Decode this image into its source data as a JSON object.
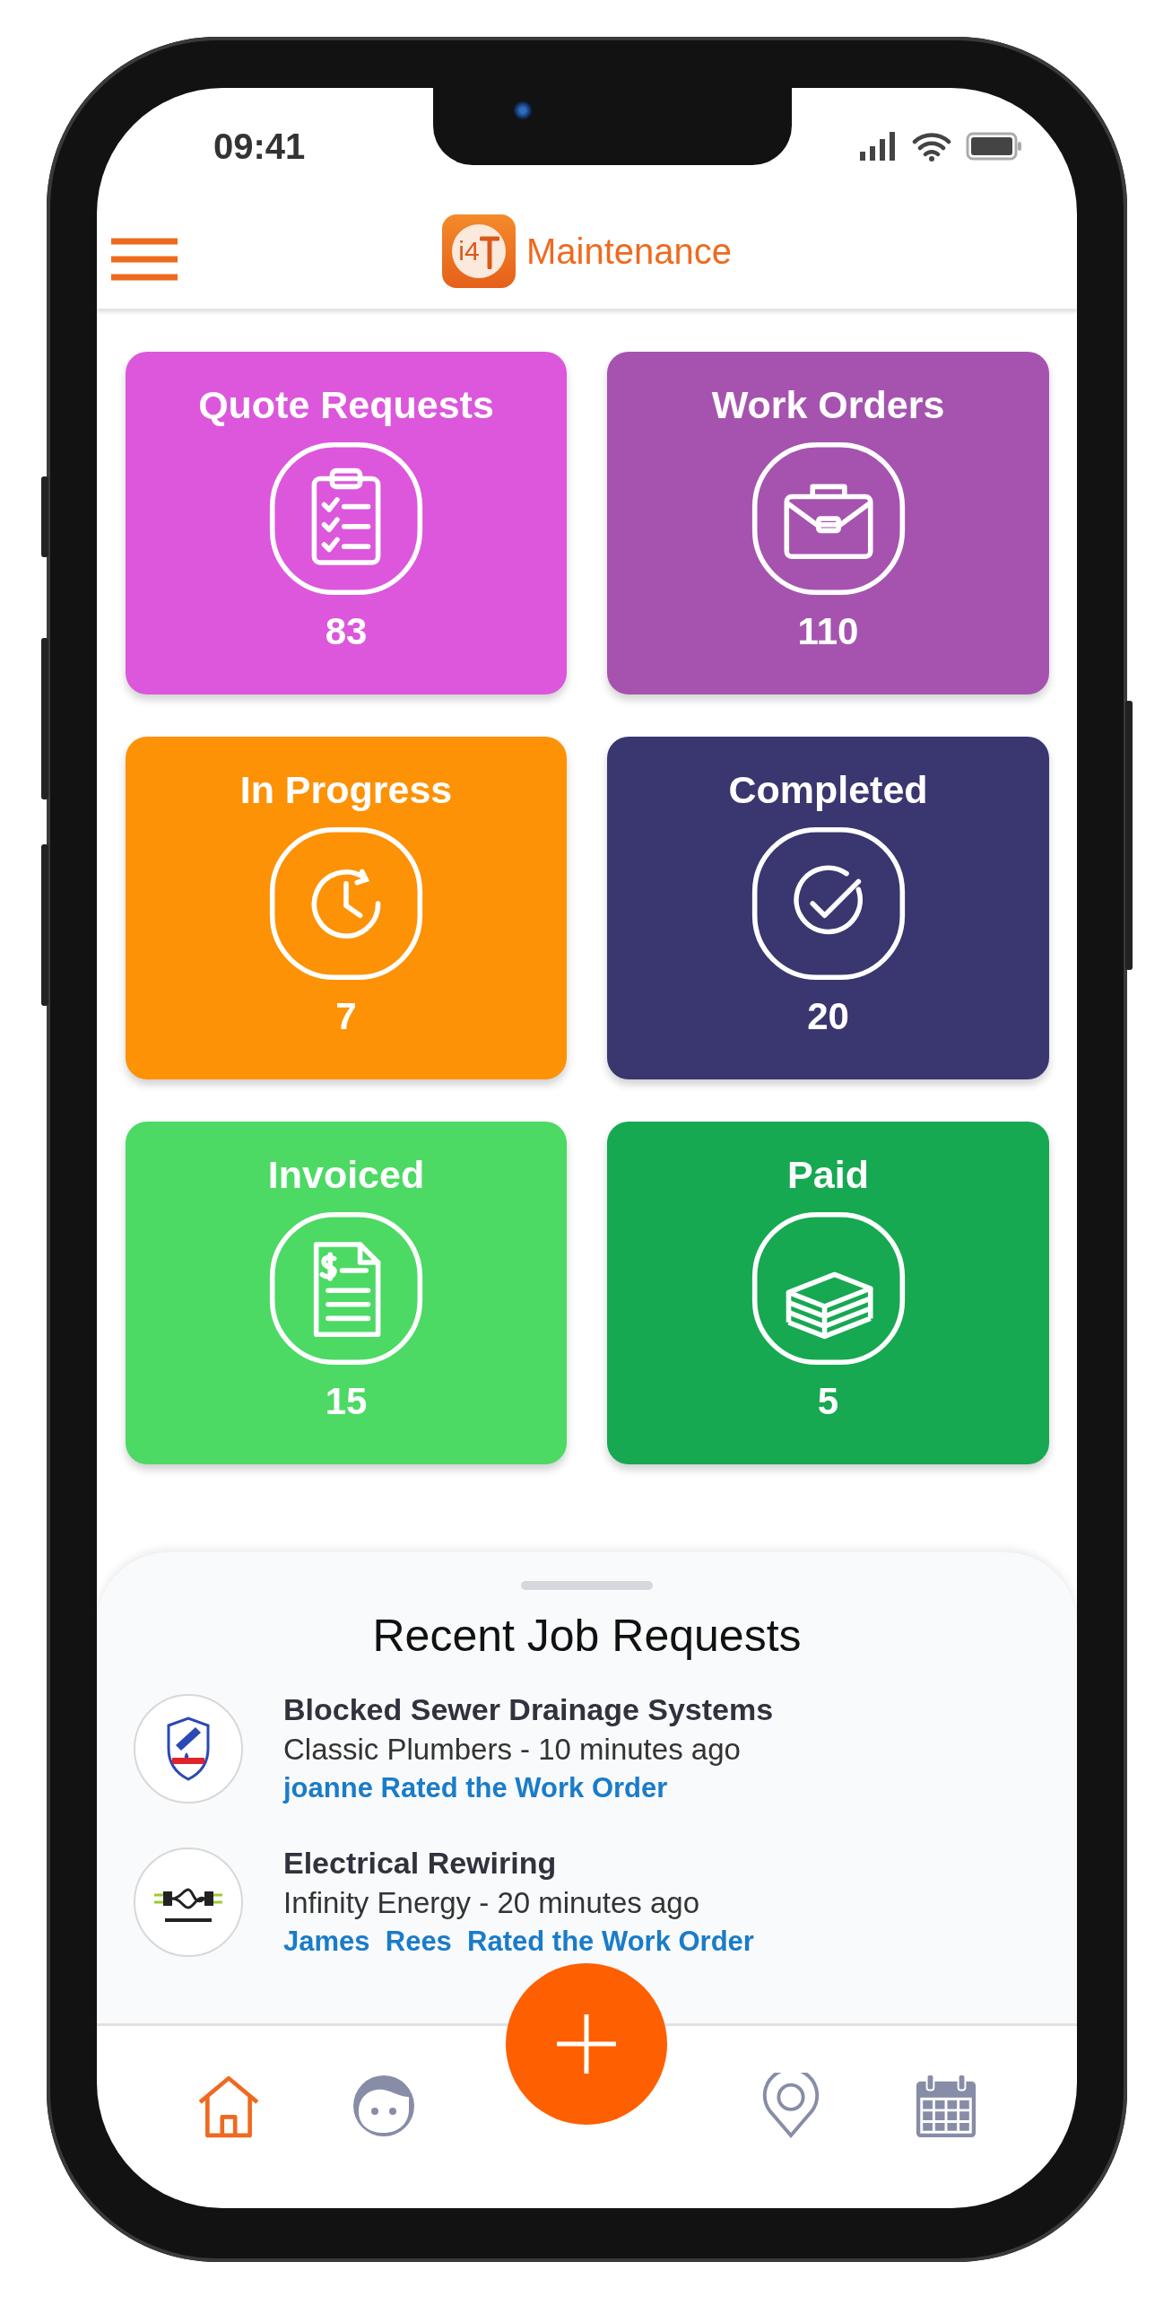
{
  "status_bar": {
    "time": "09:41"
  },
  "header": {
    "logo_mark": "i4",
    "title": "Maintenance"
  },
  "tiles": [
    {
      "label": "Quote Requests",
      "count": "83",
      "color": "#dc57dc"
    },
    {
      "label": "Work Orders",
      "count": "110",
      "color": "#a653b0"
    },
    {
      "label": "In Progress",
      "count": "7",
      "color": "#fd9206"
    },
    {
      "label": "Completed",
      "count": "20",
      "color": "#3a3670"
    },
    {
      "label": "Invoiced",
      "count": "15",
      "color": "#4cd964"
    },
    {
      "label": "Paid",
      "count": "5",
      "color": "#17a852"
    }
  ],
  "recent_jobs": {
    "title": "Recent Job Requests",
    "items": [
      {
        "title": "Blocked Sewer Drainage Systems",
        "subtitle": "Classic Plumbers - 10 minutes ago",
        "activity": "joanne Rated the Work Order"
      },
      {
        "title": "Electrical Rewiring",
        "subtitle": "Infinity Energy - 20 minutes ago",
        "activity": "James  Rees  Rated the Work Order"
      }
    ]
  },
  "bottom_nav": [
    {
      "selected": true
    },
    {
      "selected": false
    },
    {
      "selected": false
    },
    {
      "selected": false
    }
  ]
}
